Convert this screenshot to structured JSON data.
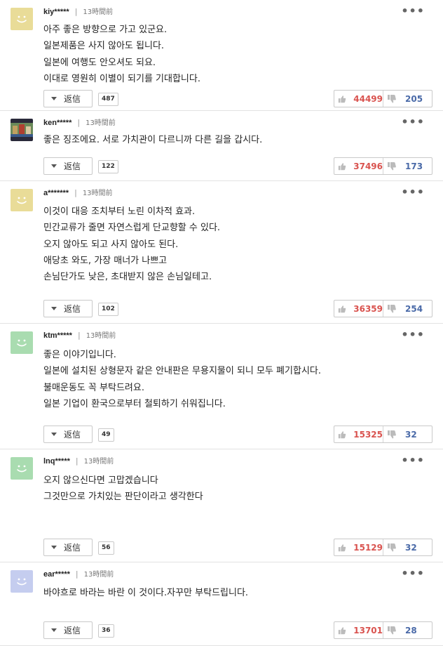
{
  "reply_label": "返信",
  "more_label": "•••",
  "comments": [
    {
      "author": "kiy*****",
      "time": "13時間前",
      "avatar": "smiley-yellow",
      "lines": [
        "아주 좋은 방향으로 가고 있군요.",
        "일본제품은 사지 않아도 됩니다.",
        "일본에 여행도 안오셔도 되요.",
        "이대로 영원히 이별이 되기를 기대합니다."
      ],
      "reply_count": "487",
      "upvotes": "44499",
      "downvotes": "205"
    },
    {
      "author": "ken*****",
      "time": "13時間前",
      "avatar": "photo-thumbnail",
      "lines": [
        "좋은 징조에요. 서로 가치관이 다르니까 다른 길을 갑시다."
      ],
      "reply_count": "122",
      "upvotes": "37496",
      "downvotes": "173"
    },
    {
      "author": "a*******",
      "time": "13時間前",
      "avatar": "smiley-yellow",
      "lines": [
        "이것이 대응 조치부터 노린 이차적 효과.",
        "민간교류가 줄면 자연스럽게 단교향할 수 있다.",
        "오지 않아도 되고 사지 않아도 된다.",
        "애당초 와도, 가장 매너가 나쁘고",
        "손님단가도 낮은, 초대받지 않은 손님일테고."
      ],
      "reply_count": "102",
      "upvotes": "36359",
      "downvotes": "254"
    },
    {
      "author": "ktm*****",
      "time": "13時間前",
      "avatar": "smiley-green",
      "lines": [
        "좋은 이야기입니다.",
        "일본에 설치된 상형문자 같은 안내판은 무용지물이 되니 모두 폐기합시다.",
        "불매운동도 꼭 부탁드려요.",
        "일본 기업이 환국으로부터 철퇴하기 쉬워집니다."
      ],
      "reply_count": "49",
      "upvotes": "15325",
      "downvotes": "32"
    },
    {
      "author": "lnq*****",
      "time": "13時間前",
      "avatar": "smiley-green",
      "lines": [
        "오지 않으신다면 고맙겠습니다",
        "그것만으로 가치있는 판단이라고 생각한다"
      ],
      "reply_count": "56",
      "upvotes": "15129",
      "downvotes": "32"
    },
    {
      "author": "ear*****",
      "time": "13時間前",
      "avatar": "smiley-blue",
      "lines": [
        "바야흐로 바라는 바란 이 것이다.자꾸만 부탁드립니다."
      ],
      "reply_count": "36",
      "upvotes": "13701",
      "downvotes": "28"
    }
  ],
  "colors": {
    "upvote": "#d9534f",
    "downvote": "#4a6aa8",
    "smiley-yellow": "#e9dc98",
    "smiley-green": "#a9dcb0",
    "smiley-blue": "#c5cdef"
  }
}
